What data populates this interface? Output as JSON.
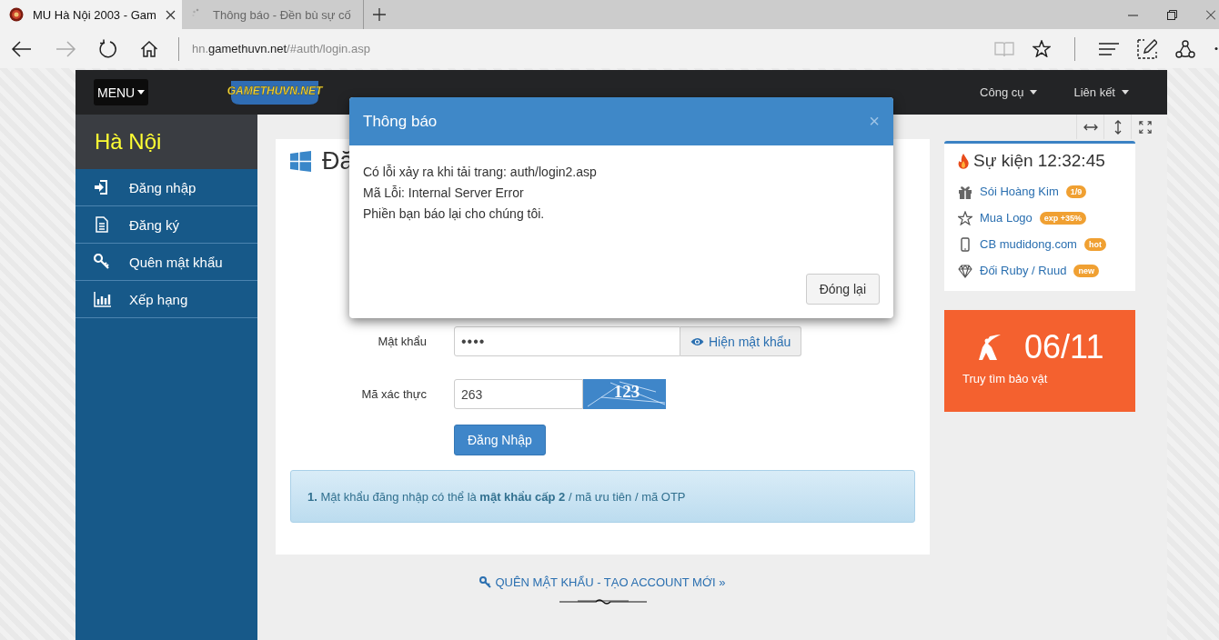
{
  "browser": {
    "tabs": [
      {
        "title": "MU Hà Nội 2003 - Gam",
        "selected": true,
        "loading": false
      },
      {
        "title": "Thông báo - Đền bù sự cố",
        "selected": false,
        "loading": true
      }
    ],
    "url": {
      "prefix": "hn.",
      "domain": "gamethuvn.net",
      "path": "/#auth/login.asp"
    }
  },
  "nav": {
    "menu_button": "MENU",
    "logo_text": "GAMETHUVN.NET",
    "links": [
      "Công cụ",
      "Liên kết"
    ]
  },
  "sidebar": {
    "title": "Hà Nội",
    "items": [
      {
        "label": "Đăng nhập"
      },
      {
        "label": "Đăng ký"
      },
      {
        "label": "Quên mật khẩu"
      },
      {
        "label": "Xếp hạng"
      }
    ]
  },
  "login": {
    "title": "Đă",
    "fields": [
      {
        "kind": "password",
        "label": "Mật khẩu",
        "value": "••••",
        "addon": "Hiện mật khẩu"
      },
      {
        "kind": "captcha",
        "label": "Mã xác thực",
        "value": "263",
        "captcha": "123"
      }
    ],
    "submit": "Đăng Nhập",
    "note": "**1.** Mật khẩu đăng nhập có thể là **mật khẩu cấp 2** / mã ưu tiên / mã OTP"
  },
  "footer_link": "QUÊN MẬT KHẨU - TẠO ACCOUNT MỚI »",
  "events": {
    "title": "Sự kiện 12:32:45",
    "items": [
      {
        "label": "Sói Hoàng Kim",
        "badge": "1/9"
      },
      {
        "label": "Mua Logo",
        "badge": "exp +35%"
      },
      {
        "label": "CB mudidong.com",
        "badge": "hot"
      },
      {
        "label": "Đối Ruby / Ruud",
        "badge": "new"
      }
    ]
  },
  "promo": {
    "value": "06/11",
    "label": "Truy tìm bảo vật"
  },
  "modal": {
    "title": "Thông báo",
    "close": "×",
    "lines": [
      "Có lỗi xảy ra khi tải trang: auth/login2.asp",
      "Mã Lỗi: Internal Server Error",
      "Phiền bạn báo lại cho chúng tôi."
    ],
    "button": "Đóng lại"
  }
}
